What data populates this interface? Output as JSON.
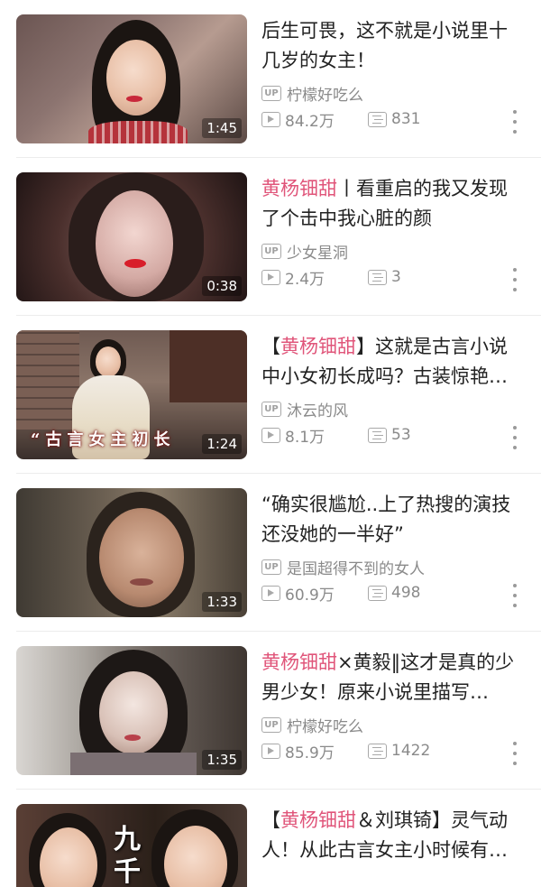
{
  "videos": [
    {
      "title_prefix": "",
      "title_highlight": "",
      "title_rest": "后生可畏，这不就是小说里十几岁的女主！",
      "duration": "1:45",
      "author": "柠檬好吃么",
      "views": "84.2万",
      "danmaku": "831",
      "overlay": ""
    },
    {
      "title_prefix": "",
      "title_highlight": "黄杨钿甜",
      "title_rest": "丨看重启的我又发现了个击中我心脏的颜",
      "duration": "0:38",
      "author": "少女星洞",
      "views": "2.4万",
      "danmaku": "3",
      "overlay": ""
    },
    {
      "title_prefix": "【",
      "title_highlight": "黄杨钿甜",
      "title_rest": "】这就是古言小说中小女初长成吗？古装惊艳到…",
      "duration": "1:24",
      "author": "沐云的风",
      "views": "8.1万",
      "danmaku": "53",
      "overlay": "“古言女主初长"
    },
    {
      "title_prefix": "",
      "title_highlight": "",
      "title_rest": "“确实很尴尬..上了热搜的演技还没她的一半好”",
      "duration": "1:33",
      "author": "是国超得不到的女人",
      "views": "60.9万",
      "danmaku": "498",
      "overlay": ""
    },
    {
      "title_prefix": "",
      "title_highlight": "黄杨钿甜",
      "title_rest": "×黄毅‖这才是真的少男少女！原来小说里描写…",
      "duration": "1:35",
      "author": "柠檬好吃么",
      "views": "85.9万",
      "danmaku": "1422",
      "overlay": ""
    },
    {
      "title_prefix": "【",
      "title_highlight": "黄杨钿甜",
      "title_rest": "＆刘琪锜】灵气动人！从此古言女主小时候有…",
      "duration": "",
      "author": "",
      "views": "",
      "danmaku": "",
      "overlay": "九千岁"
    }
  ],
  "badge_label": "UP",
  "colors": {
    "highlight": "#e0557a",
    "meta": "#8a8a8a",
    "title": "#222222"
  },
  "icons": {
    "views": "play-icon",
    "danmaku": "danmaku-list-icon",
    "menu": "more-vertical-icon"
  }
}
